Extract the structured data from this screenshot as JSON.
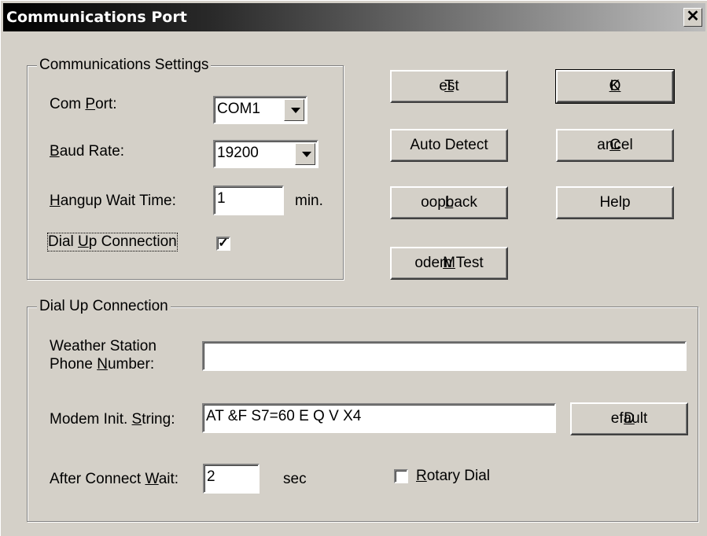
{
  "window": {
    "title": "Communications Port",
    "close_symbol": "✕"
  },
  "comm_settings": {
    "legend": "Communications Settings",
    "com_port": {
      "label_pre": "Com ",
      "label_u": "P",
      "label_post": "ort:",
      "value": "COM1"
    },
    "baud_rate": {
      "label_pre": "",
      "label_u": "B",
      "label_post": "aud Rate:",
      "value": "19200"
    },
    "hangup": {
      "label_pre": "",
      "label_u": "H",
      "label_post": "angup Wait Time:",
      "value": "1",
      "unit": "min."
    },
    "dialup": {
      "label_pre": "Dial ",
      "label_u": "U",
      "label_post": "p Connection",
      "checked": true,
      "check_mark": "✓"
    }
  },
  "buttons": {
    "test": {
      "pre": "",
      "u": "T",
      "post": "est"
    },
    "auto_detect": {
      "pre": "Auto Detect",
      "u": "",
      "post": ""
    },
    "loopback": {
      "pre": "",
      "u": "L",
      "post": "oopback"
    },
    "modem_test": {
      "pre": "",
      "u": "M",
      "post": "odem Test"
    },
    "ok": {
      "pre": "",
      "u": "O",
      "post": "K"
    },
    "cancel": {
      "pre": "",
      "u": "C",
      "post": "ancel"
    },
    "help": {
      "pre": "Help",
      "u": "",
      "post": ""
    },
    "default": {
      "pre": "",
      "u": "D",
      "post": "efault"
    }
  },
  "dialup_group": {
    "legend": "Dial Up Connection",
    "phone": {
      "line1": "Weather Station",
      "line2_pre": "Phone ",
      "line2_u": "N",
      "line2_post": "umber:",
      "value": ""
    },
    "init": {
      "label_pre": "Modem Init. ",
      "label_u": "S",
      "label_post": "tring:",
      "value": "AT &F S7=60 E Q V X4"
    },
    "after_wait": {
      "label_pre": "After Connect ",
      "label_u": "W",
      "label_post": "ait:",
      "value": "2",
      "unit": "sec"
    },
    "rotary": {
      "label_pre": "",
      "label_u": "R",
      "label_post": "otary Dial",
      "checked": false
    }
  }
}
